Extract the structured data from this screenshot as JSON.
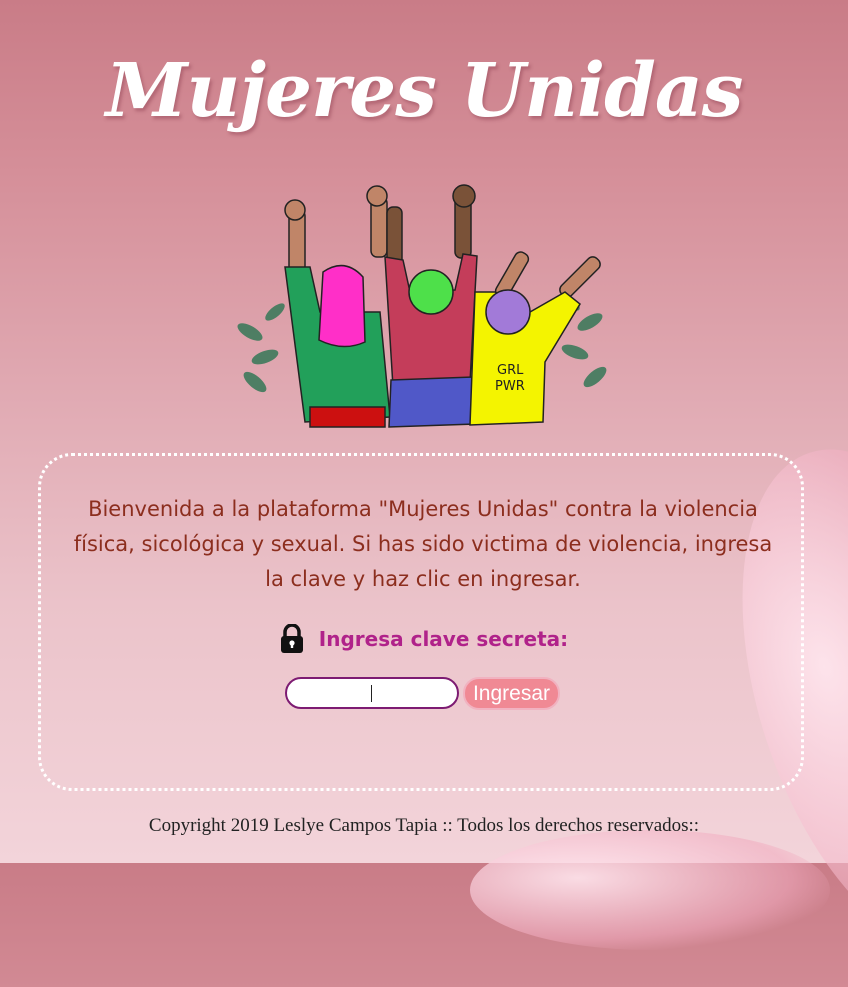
{
  "header": {
    "title": "Mujeres Unidas"
  },
  "illustration": {
    "shirt_text_line1": "GRL",
    "shirt_text_line2": "PWR"
  },
  "main": {
    "welcome_text": "Bienvenida a la plataforma \"Mujeres Unidas\" contra la violencia física, sicológica y sexual. Si has sido victima de violencia, ingresa la clave y haz clic en ingresar.",
    "secret_label": "Ingresa clave secreta:",
    "secret_icon": "lock-icon",
    "password_value": "",
    "submit_label": "Ingresar"
  },
  "footer": {
    "copyright": "Copyright 2019 Leslye Campos Tapia :: Todos los derechos reservados::"
  },
  "colors": {
    "title": "#ffffff",
    "welcome_text": "#8c2e1e",
    "secret_label": "#b0228a",
    "button_bg": "#f08994",
    "input_border": "#7d1b72",
    "panel_border": "#ffffff"
  }
}
